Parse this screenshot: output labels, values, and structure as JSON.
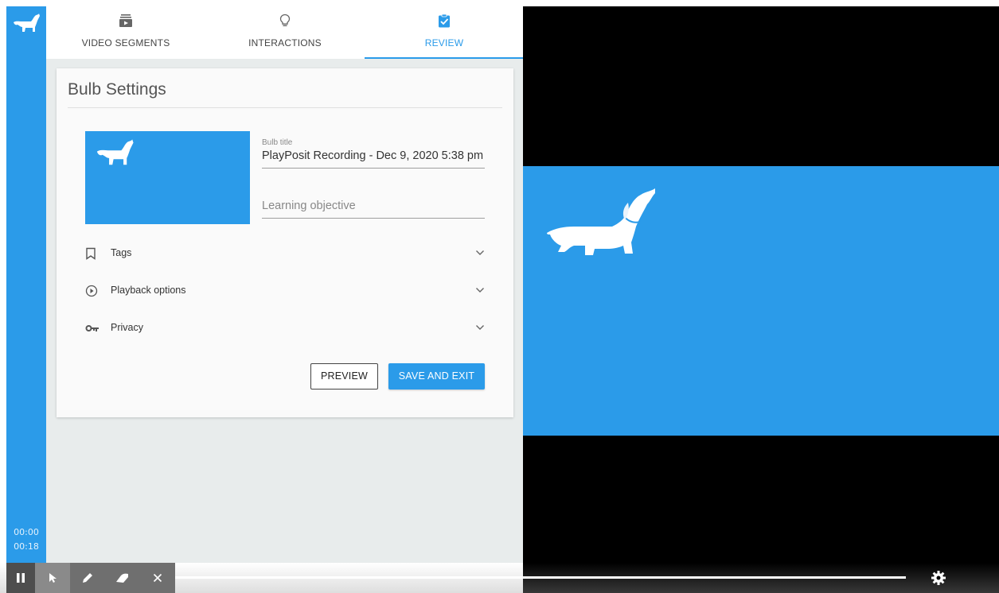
{
  "sidebar": {
    "logo": "dachshund-logo-icon",
    "time_current": "00:00",
    "time_total": "00:18"
  },
  "tabs": [
    {
      "label": "VIDEO SEGMENTS",
      "icon": "video-segments-icon",
      "active": false
    },
    {
      "label": "INTERACTIONS",
      "icon": "lightbulb-icon",
      "active": false
    },
    {
      "label": "REVIEW",
      "icon": "clipboard-check-icon",
      "active": true
    }
  ],
  "settings": {
    "title": "Bulb Settings",
    "bulb_title_label": "Bulb title",
    "bulb_title_value": "PlayPosit Recording - Dec 9, 2020 5:38 pm",
    "learning_objective_placeholder": "Learning objective",
    "sections": [
      {
        "label": "Tags",
        "icon": "bookmark-icon"
      },
      {
        "label": "Playback options",
        "icon": "play-circle-icon"
      },
      {
        "label": "Privacy",
        "icon": "key-icon"
      }
    ],
    "preview_label": "PREVIEW",
    "save_label": "SAVE AND EXIT"
  },
  "controls": {
    "tools": [
      "pause-icon",
      "cursor-icon",
      "pen-icon",
      "eraser-icon",
      "close-icon"
    ],
    "settings_icon": "gear-icon",
    "progress": 0
  },
  "colors": {
    "brand_blue": "#2b9be9",
    "panel_bg": "#e8ecec",
    "video_bg": "#000000"
  }
}
